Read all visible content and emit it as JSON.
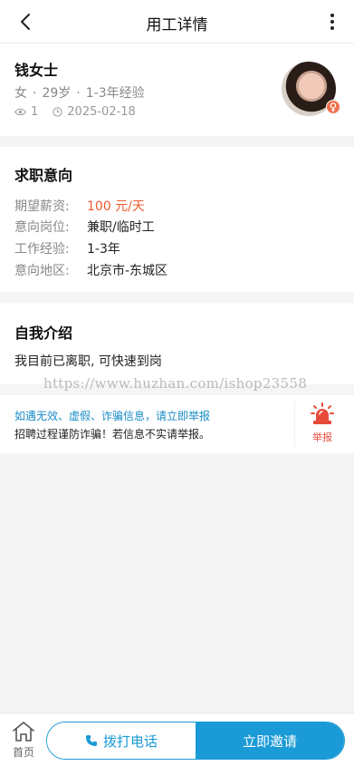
{
  "header": {
    "title": "用工详情",
    "back_icon": "chevron-left-icon",
    "more_icon": "more-vertical-icon"
  },
  "profile": {
    "name": "钱女士",
    "gender": "女",
    "age": "29岁",
    "experience": "1-3年经验",
    "views": "1",
    "date": "2025-02-18",
    "gender_badge_icon": "female-icon"
  },
  "intent": {
    "title": "求职意向",
    "rows": [
      {
        "label": "期望薪资:",
        "value": "100 元/天"
      },
      {
        "label": "意向岗位:",
        "value": "兼职/临时工"
      },
      {
        "label": "工作经验:",
        "value": "1-3年"
      },
      {
        "label": "意向地区:",
        "value": "北京市-东城区"
      }
    ]
  },
  "intro": {
    "title": "自我介绍",
    "text": "我目前已离职, 可快速到岗"
  },
  "watermark": "https://www.huzhan.com/ishop23558",
  "report": {
    "line1": "如遇无效、虚假、诈骗信息，请立即举报",
    "line2": "招聘过程谨防诈骗！若信息不实请举报。",
    "button_label": "举报"
  },
  "bottom": {
    "home_label": "首页",
    "call_label": "拨打电话",
    "invite_label": "立即邀请"
  },
  "colors": {
    "accent": "#1a9ad6",
    "salary": "#f05a32",
    "report_red": "#e84a3a",
    "badge": "#f07050"
  }
}
